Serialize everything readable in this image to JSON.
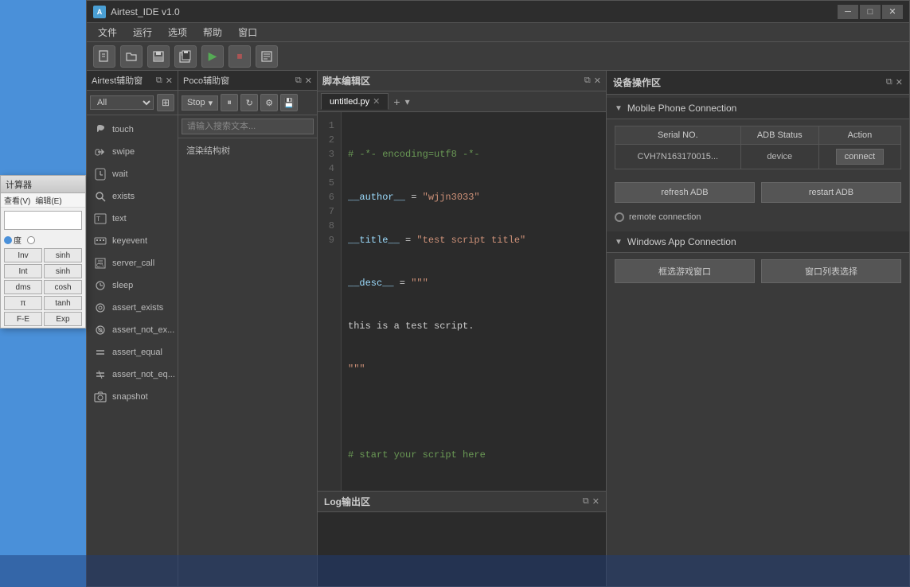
{
  "window": {
    "title": "Airtest_IDE v1.0",
    "icon": "A"
  },
  "menu": {
    "items": [
      "文件",
      "运行",
      "选项",
      "帮助",
      "窗口"
    ]
  },
  "toolbar": {
    "buttons": [
      "new",
      "open",
      "save",
      "save-all",
      "play",
      "stop",
      "log"
    ]
  },
  "airtest_panel": {
    "title": "Airtest辅助窗",
    "filter": "All",
    "items": [
      {
        "icon": "👆",
        "label": "touch"
      },
      {
        "icon": "👆",
        "label": "swipe"
      },
      {
        "icon": "⏳",
        "label": "wait"
      },
      {
        "icon": "🔍",
        "label": "exists"
      },
      {
        "icon": "T",
        "label": "text"
      },
      {
        "icon": "⌨",
        "label": "keyevent"
      },
      {
        "icon": "💻",
        "label": "server_call"
      },
      {
        "icon": "🕐",
        "label": "sleep"
      },
      {
        "icon": "👁",
        "label": "assert_exists"
      },
      {
        "icon": "👁",
        "label": "assert_not_ex..."
      },
      {
        "icon": "≡",
        "label": "assert_equal"
      },
      {
        "icon": "≠",
        "label": "assert_not_eq..."
      },
      {
        "icon": "📷",
        "label": "snapshot"
      }
    ]
  },
  "poco_panel": {
    "title": "Poco辅助窗",
    "stop_label": "Stop",
    "search_placeholder": "请输入搜索文本...",
    "tree_item": "渲染结构树"
  },
  "editor": {
    "title": "脚本编辑区",
    "tab_name": "untitled.py",
    "code_lines": [
      {
        "num": 1,
        "content": "# -*- encoding=utf8 -*-",
        "type": "comment"
      },
      {
        "num": 2,
        "content": "__author__ = \"wjjn3033\"",
        "type": "string"
      },
      {
        "num": 3,
        "content": "__title__ = \"test script title\"",
        "type": "string"
      },
      {
        "num": 4,
        "content": "__desc__ = \"\"\"",
        "type": "string"
      },
      {
        "num": 5,
        "content": "this is a test script.",
        "type": "plain"
      },
      {
        "num": 6,
        "content": "\"\"\"",
        "type": "string"
      },
      {
        "num": 7,
        "content": "",
        "type": "plain"
      },
      {
        "num": 8,
        "content": "# start your script here",
        "type": "comment"
      },
      {
        "num": 9,
        "content": "",
        "type": "cursor"
      }
    ]
  },
  "log_panel": {
    "title": "Log输出区"
  },
  "device_panel": {
    "title": "设备操作区",
    "mobile_section": "Mobile Phone Connection",
    "table_headers": [
      "Serial NO.",
      "ADB Status",
      "Action"
    ],
    "device_row": {
      "serial": "CVH7N163170015...",
      "status": "device",
      "action": "connect"
    },
    "refresh_adb": "refresh ADB",
    "restart_adb": "restart ADB",
    "remote_connection": "remote connection",
    "windows_section": "Windows App Connection",
    "frame_window": "框选游戏窗口",
    "window_list": "窗口列表选择"
  },
  "calculator": {
    "title": "计算器",
    "menu_items": [
      "查看(V)",
      "编辑(E)"
    ],
    "display_value": "",
    "radio_left": "度",
    "radio_right": "",
    "buttons": [
      [
        "Inv",
        "sinh"
      ],
      [
        "Int",
        "sinh"
      ],
      [
        "dms",
        "cosh"
      ],
      [
        "π",
        "tanh"
      ],
      [
        "F-E",
        "Exp"
      ]
    ]
  }
}
